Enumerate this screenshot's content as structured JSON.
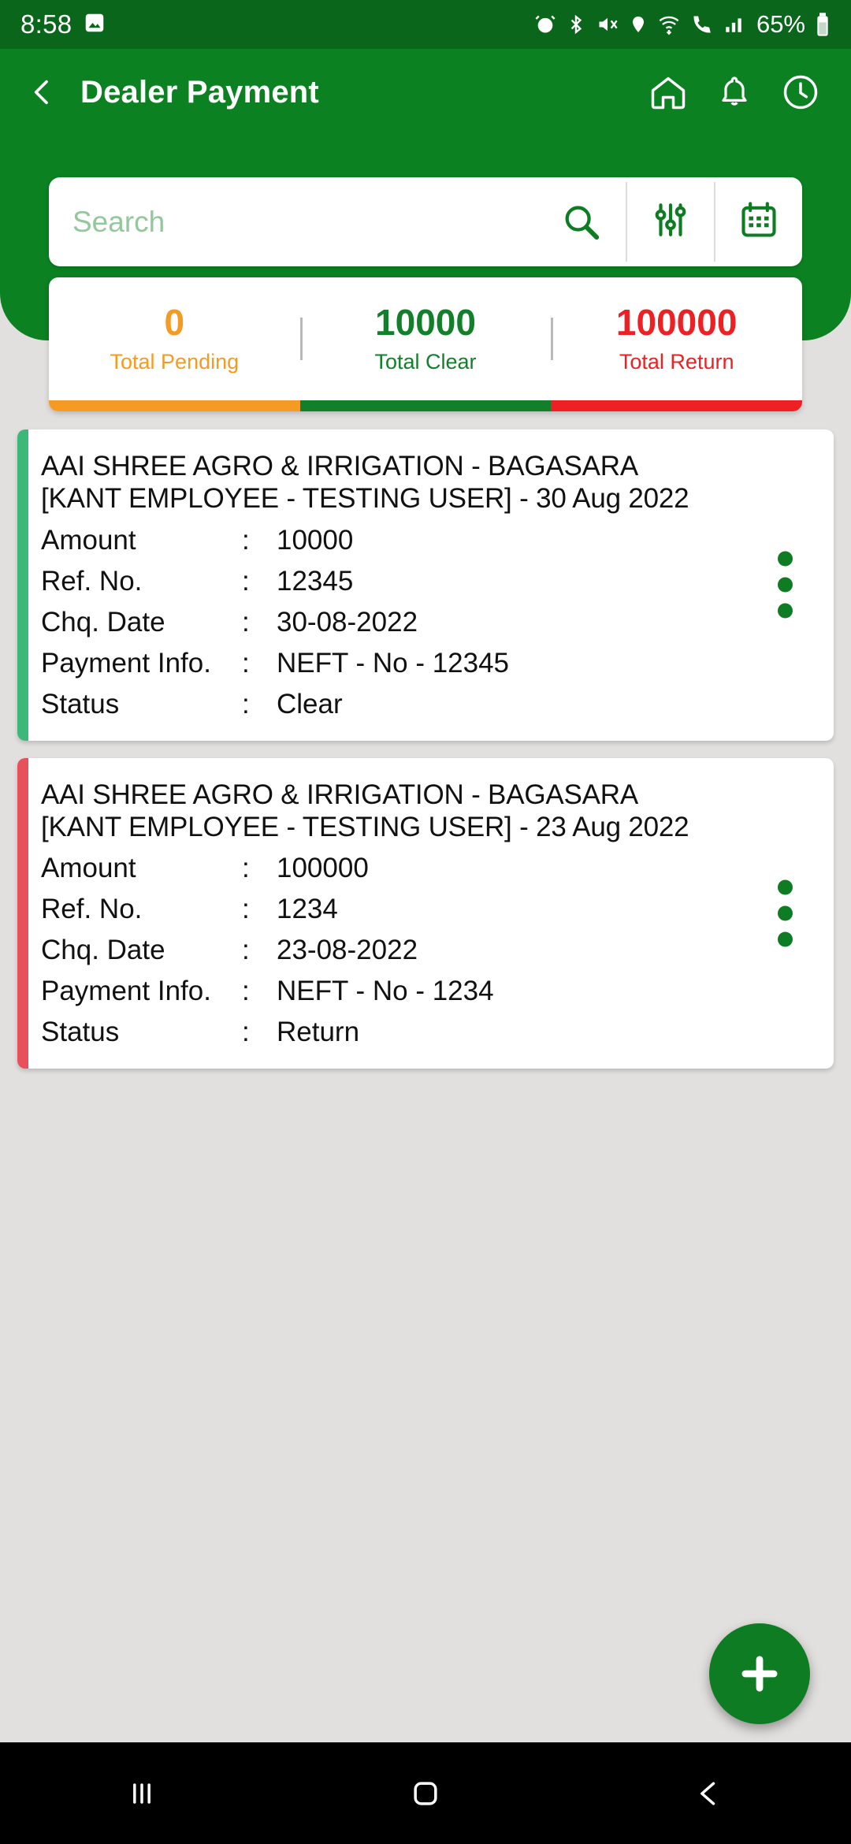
{
  "status_bar": {
    "time": "8:58",
    "battery_percent": "65%",
    "icons": [
      "image-icon",
      "alarm-icon",
      "bluetooth-icon",
      "mute-icon",
      "location-icon",
      "wifi-icon",
      "call-icon",
      "signal-icon",
      "battery-icon"
    ]
  },
  "app_bar": {
    "title": "Dealer Payment",
    "back_icon": "back-chevron-icon",
    "actions": [
      "home-icon",
      "bell-icon",
      "clock-icon"
    ]
  },
  "search": {
    "placeholder": "Search",
    "value": "",
    "search_icon": "search-icon",
    "filter_icon": "filter-sliders-icon",
    "calendar_icon": "calendar-icon"
  },
  "summary": {
    "items": [
      {
        "value": "0",
        "label": "Total Pending",
        "color": "#f59a23"
      },
      {
        "value": "10000",
        "label": "Total Clear",
        "color": "#12802a"
      },
      {
        "value": "100000",
        "label": "Total Return",
        "color": "#ed2024"
      }
    ]
  },
  "labels": {
    "amount": "Amount",
    "ref_no": "Ref. No.",
    "chq_date": "Chq. Date",
    "payment_info": "Payment Info.",
    "status": "Status",
    "colon": ":"
  },
  "payments": [
    {
      "title": "AAI SHREE AGRO & IRRIGATION - BAGASARA [KANT EMPLOYEE - TESTING USER] - 30 Aug 2022",
      "amount": "10000",
      "ref_no": "12345",
      "chq_date": "30-08-2022",
      "payment_info": "NEFT  - No - 12345",
      "status": "Clear",
      "accent": "#3cb878"
    },
    {
      "title": "AAI SHREE AGRO & IRRIGATION - BAGASARA [KANT EMPLOYEE - TESTING USER] - 23 Aug 2022",
      "amount": "100000",
      "ref_no": "1234",
      "chq_date": "23-08-2022",
      "payment_info": "NEFT  - No - 1234",
      "status": "Return",
      "accent": "#e8505b"
    }
  ],
  "fab": {
    "icon": "plus-icon",
    "color": "#0e7c22"
  },
  "nav_bar": {
    "recents_icon": "recents-icon",
    "home_icon": "home-square-icon",
    "back_icon": "back-chevron-icon"
  },
  "theme": {
    "header_green": "#0b8121",
    "status_green": "#09661b",
    "page_bg": "#e2e0de"
  }
}
